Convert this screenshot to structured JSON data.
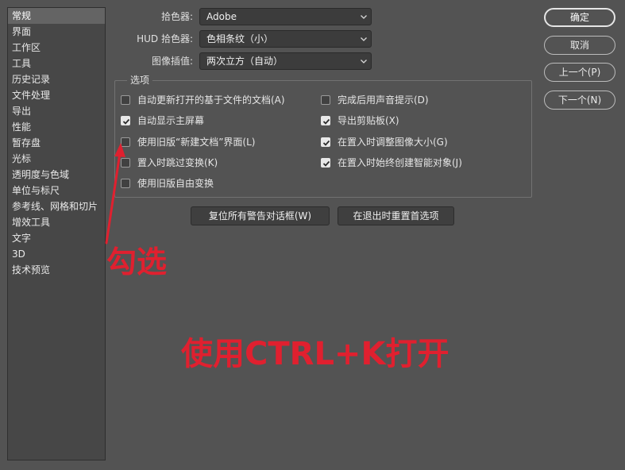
{
  "sidebar": {
    "items": [
      {
        "label": "常规",
        "selected": true
      },
      {
        "label": "界面"
      },
      {
        "label": "工作区"
      },
      {
        "label": "工具"
      },
      {
        "label": "历史记录"
      },
      {
        "label": "文件处理"
      },
      {
        "label": "导出"
      },
      {
        "label": "性能"
      },
      {
        "label": "暂存盘"
      },
      {
        "label": "光标"
      },
      {
        "label": "透明度与色域"
      },
      {
        "label": "单位与标尺"
      },
      {
        "label": "参考线、网格和切片"
      },
      {
        "label": "增效工具"
      },
      {
        "label": "文字"
      },
      {
        "label": "3D"
      },
      {
        "label": "技术预览"
      }
    ]
  },
  "fields": {
    "color_picker": {
      "label": "拾色器:",
      "value": "Adobe"
    },
    "hud_color_picker": {
      "label": "HUD 拾色器:",
      "value": "色相条纹（小）"
    },
    "interpolation": {
      "label": "图像插值:",
      "value": "两次立方（自动）"
    }
  },
  "options": {
    "legend": "选项",
    "left": [
      {
        "label": "自动更新打开的基于文件的文档(A)",
        "checked": false
      },
      {
        "label": "自动显示主屏幕",
        "checked": true
      },
      {
        "label": "使用旧版“新建文档”界面(L)",
        "checked": false
      },
      {
        "label": "置入时跳过变换(K)",
        "checked": false
      },
      {
        "label": "使用旧版自由变换",
        "checked": false
      }
    ],
    "right": [
      {
        "label": "完成后用声音提示(D)",
        "checked": false
      },
      {
        "label": "导出剪贴板(X)",
        "checked": true
      },
      {
        "label": "在置入时调整图像大小(G)",
        "checked": true
      },
      {
        "label": "在置入时始终创建智能对象(J)",
        "checked": true
      }
    ]
  },
  "actions": {
    "reset_warnings": "复位所有警告对话框(W)",
    "reset_on_quit": "在退出时重置首选项"
  },
  "dialog_buttons": {
    "ok": "确定",
    "cancel": "取消",
    "prev": "上一个(P)",
    "next": "下一个(N)"
  },
  "annotations": {
    "check_hint": "勾选",
    "shortcut_hint": "使用CTRL+K打开",
    "color": "#e0202f"
  },
  "colors": {
    "background": "#535353",
    "sidebar_bg": "#474747",
    "selected_bg": "#646464",
    "annotation": "#e0202f"
  }
}
